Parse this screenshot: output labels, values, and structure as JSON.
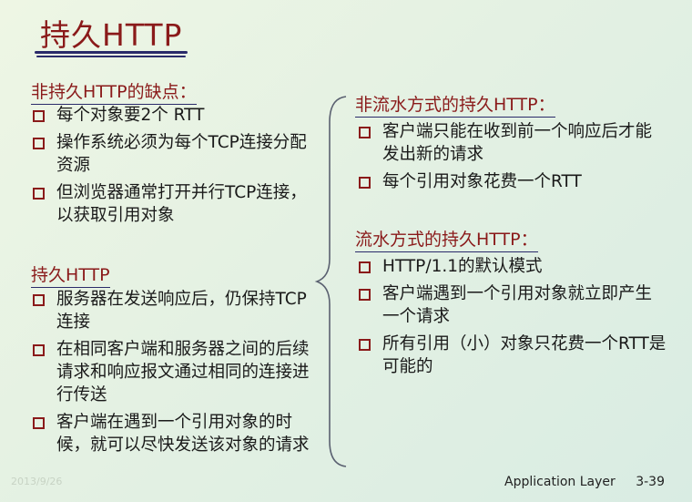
{
  "slide": {
    "title": "持久HTTP",
    "left": {
      "heading1": "非持久HTTP的缺点：",
      "items1": [
        "每个对象要2个 RTT",
        "操作系统必须为每个TCP连接分配资源",
        "但浏览器通常打开并行TCP连接，以获取引用对象"
      ],
      "heading2": "持久HTTP",
      "items2": [
        "服务器在发送响应后，仍保持TCP连接",
        "在相同客户端和服务器之间的后续请求和响应报文通过相同的连接进行传送",
        "客户端在遇到一个引用对象的时候，就可以尽快发送该对象的请求"
      ]
    },
    "right": {
      "heading1": "非流水方式的持久HTTP：",
      "items1": [
        "客户端只能在收到前一个响应后才能发出新的请求",
        "每个引用对象花费一个RTT"
      ],
      "heading2": "流水方式的持久HTTP：",
      "items2": [
        "HTTP/1.1的默认模式",
        "客户端遇到一个引用对象就立即产生一个请求",
        "所有引用（小）对象只花费一个RTT是可能的"
      ]
    },
    "footer": {
      "label": "Application Layer",
      "page": "3-39"
    },
    "watermark": "2013/9/26"
  },
  "colors": {
    "heading": "#8a1a1a",
    "underline": "#2a2a6a",
    "background": "#e4f1e3"
  },
  "icons": {
    "bullet": "hollow-square-bullet",
    "divider": "curly-brace"
  }
}
